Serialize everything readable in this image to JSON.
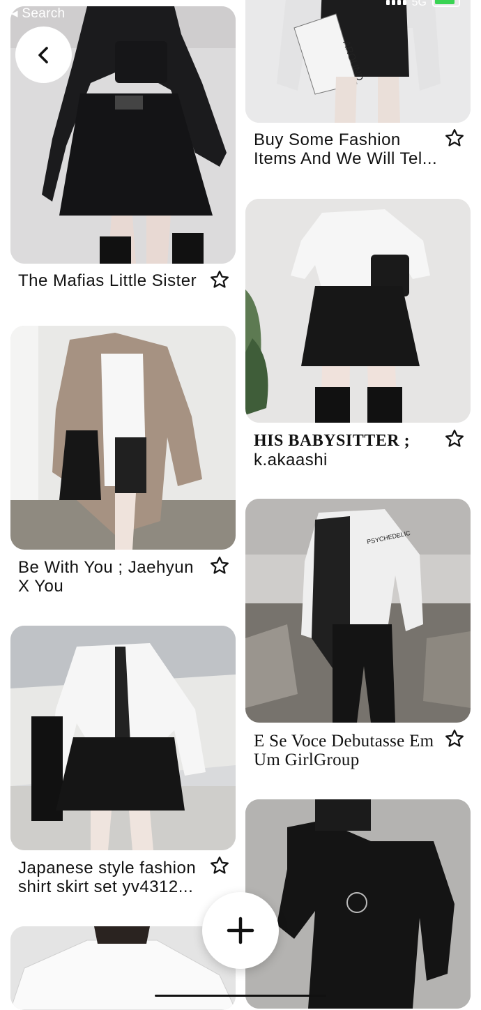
{
  "status_bar": {
    "back_to_app": "◂ Search",
    "network": "5G",
    "battery_color": "#39d353"
  },
  "navigation": {
    "back_icon": "chevron-left-icon",
    "add_icon": "plus-icon"
  },
  "pins": [
    {
      "id": "pin-1",
      "title": "The Mafias Little Sister",
      "icon": "star-icon"
    },
    {
      "id": "pin-2",
      "title": "Buy Some Fashion Items And We Will Tel...",
      "icon": "star-icon"
    },
    {
      "id": "pin-3",
      "title": "HIS BABYSITTER ; k.akaashi",
      "title_part1": "HIS BABYSITTER ;",
      "title_part2": "k.akaashi",
      "icon": "star-icon"
    },
    {
      "id": "pin-4",
      "title": "Be With You ; Jaehyun X You",
      "icon": "star-icon"
    },
    {
      "id": "pin-5",
      "title": "E Se Voce Debutasse Em Um GirlGroup",
      "icon": "star-icon"
    },
    {
      "id": "pin-6",
      "title": "Japanese style fashion shirt skirt set yv4312...",
      "icon": "star-icon"
    }
  ]
}
